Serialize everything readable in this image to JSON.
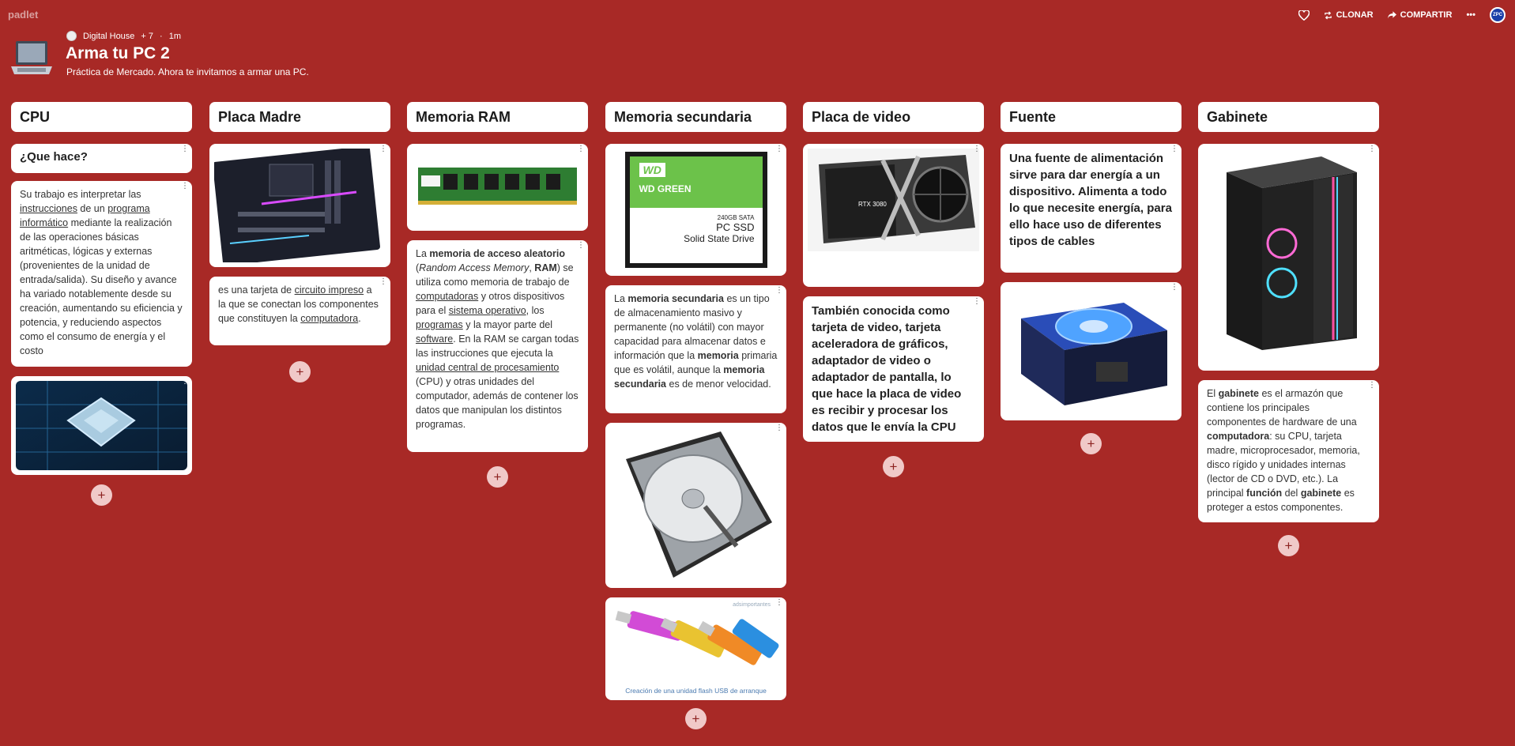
{
  "app": {
    "logo": "padlet"
  },
  "actions": {
    "clone": "CLONAR",
    "share": "COMPARTIR",
    "more": "•••",
    "avatar": "ZPC"
  },
  "header": {
    "author": "Digital House",
    "contributors": "+ 7",
    "time": "1m",
    "title": "Arma tu PC 2",
    "subtitle": "Práctica de Mercado. Ahora te invitamos a armar una PC."
  },
  "columns": {
    "cpu": {
      "title": "CPU",
      "q": "¿Que hace?",
      "t1": "Su trabajo es interpretar las ",
      "l1": "instrucciones",
      "t2": " de un ",
      "l2": "programa informático",
      "t3": " mediante la realización de las operaciones básicas aritméticas, lógicas y externas (provenientes de la unidad de entrada/salida). Su diseño y avance ha variado notablemente desde su creación, aumentando su eficiencia y potencia, y reduciendo aspectos como el consumo de energía y el costo"
    },
    "mb": {
      "title": "Placa Madre",
      "t1": "es una tarjeta de ",
      "l1": "circuito impreso",
      "t2": " a la que se conectan los componentes que constituyen la ",
      "l2": "computadora",
      "t3": "."
    },
    "ram": {
      "title": "Memoria RAM",
      "t1": "La ",
      "b1": "memoria de acceso aleatorio",
      "t2": " (",
      "i1": "Random Access Memory",
      "t3": ", ",
      "b2": "RAM",
      "t4": ") se utiliza como memoria de trabajo de ",
      "l1": "computadoras",
      "t5": " y otros dispositivos para el ",
      "l2": "sistema operativo",
      "t6": ", los ",
      "l3": "programas",
      "t7": " y la mayor parte del ",
      "l4": "software",
      "t8": ". En la RAM se cargan todas las instrucciones que ejecuta la ",
      "l5": "unidad central de procesamiento",
      "t9": " (CPU) y otras unidades del computador, además de contener los datos que manipulan los distintos programas."
    },
    "sec": {
      "title": "Memoria secundaria",
      "t1": "La ",
      "b1": "memoria secundaria",
      "t2": " es un tipo de almacenamiento masivo y permanente (no volátil) con mayor capacidad para almacenar datos e información que la ",
      "b2": "memoria",
      "t3": " primaria que es volátil, aunque la ",
      "b3": "memoria secundaria",
      "t4": " es de menor velocidad.",
      "ssd_brand": "WD",
      "ssd_line": "WD GREEN",
      "ssd_cap": "240GB SATA",
      "ssd_type": "PC SSD",
      "ssd_desc": "Solid State Drive",
      "usb_caption": "Creación de una unidad flash USB de arranque",
      "usb_watermark": "adsimportantes"
    },
    "gpu": {
      "title": "Placa de video",
      "gpu_label": "RTX 3080",
      "text": "También conocida como tarjeta de video, tarjeta aceleradora de gráficos, adaptador de video o adaptador de pantalla, lo que hace la placa de video es recibir y procesar los datos que le envía la CPU"
    },
    "psu": {
      "title": "Fuente",
      "text": "Una fuente de alimentación sirve para dar energía a un dispositivo. Alimenta a todo lo que necesite energía, para ello hace uso de diferentes tipos de cables"
    },
    "case": {
      "title": "Gabinete",
      "t1": "El ",
      "b1": "gabinete",
      "t2": " es el armazón que contiene los principales componentes de hardware de una ",
      "b2": "computadora",
      "t3": ": su CPU, tarjeta madre, microprocesador, memoria, disco rígido y unidades internas (lector de CD o DVD, etc.). La principal ",
      "b3": "función",
      "t4": " del ",
      "b4": "gabinete",
      "t5": " es proteger a estos componentes."
    }
  },
  "plus": "+",
  "colors": {
    "background": "#a82926",
    "plus_bg": "#f0c9c8"
  }
}
